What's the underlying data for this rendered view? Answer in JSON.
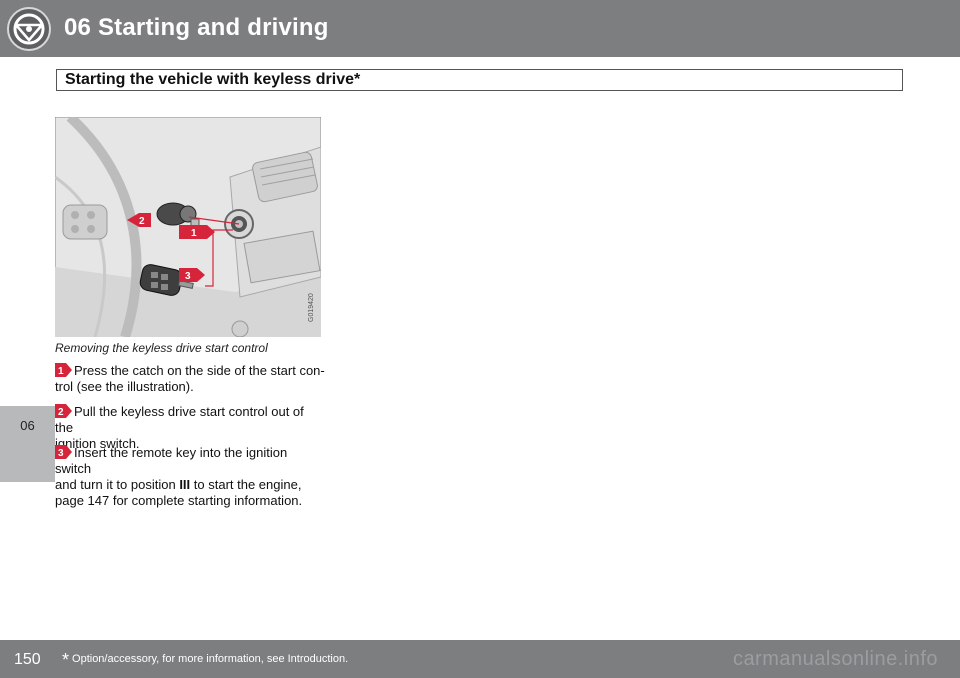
{
  "header": {
    "title": "06 Starting and driving"
  },
  "section": {
    "title": "Starting the vehicle with keyless drive*"
  },
  "side_tab": {
    "label": "06"
  },
  "figure": {
    "code": "G019420",
    "callouts": [
      "1",
      "2",
      "3"
    ],
    "caption": "Removing the keyless drive start control"
  },
  "steps": [
    {
      "number": "1",
      "line1": "Press the catch on the side of the start con-",
      "line2": "trol (see the illustration)."
    },
    {
      "number": "2",
      "line1": "Pull the keyless drive start control out of the",
      "line2": "ignition switch."
    },
    {
      "number": "3",
      "line1": "Insert the remote key into the ignition switch",
      "line2_pre": "and turn it to position ",
      "position": "III",
      "line2_post": " to start the engine,",
      "line3": "page 147 for complete starting information."
    }
  ],
  "footer": {
    "page_number": "150",
    "footnote_star": "*",
    "footnote_text": "Option/accessory, for more information, see Introduction.",
    "watermark": "carmanualsonline.info"
  },
  "colors": {
    "header": "#7d7e80",
    "accent_red": "#d6243b",
    "side_tab": "#b8b9bb"
  }
}
